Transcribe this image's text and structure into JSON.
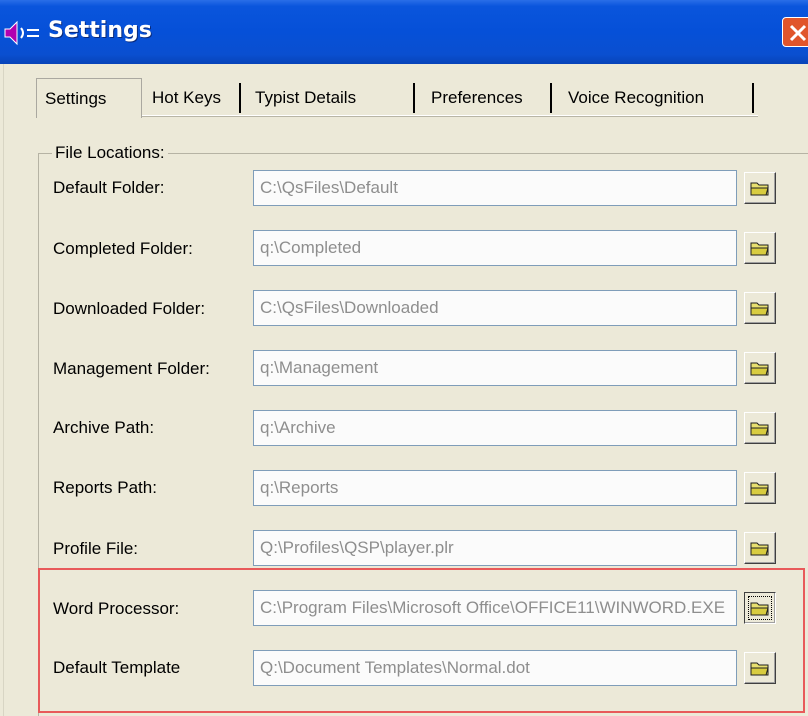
{
  "window": {
    "title": "Settings",
    "app_icon": "speaker-icon",
    "close_icon": "close-icon"
  },
  "tabs": [
    {
      "label": "Settings",
      "active": true
    },
    {
      "label": "Hot Keys"
    },
    {
      "label": "Typist Details"
    },
    {
      "label": "Preferences"
    },
    {
      "label": "Voice Recognition"
    }
  ],
  "group": {
    "label": "File Locations:"
  },
  "rows": [
    {
      "label": "Default Folder:",
      "value": "C:\\QsFiles\\Default"
    },
    {
      "label": "Completed Folder:",
      "value": "q:\\Completed"
    },
    {
      "label": "Downloaded Folder:",
      "value": "C:\\QsFiles\\Downloaded"
    },
    {
      "label": "Management Folder:",
      "value": "q:\\Management"
    },
    {
      "label": "Archive Path:",
      "value": "q:\\Archive"
    },
    {
      "label": "Reports Path:",
      "value": "q:\\Reports"
    },
    {
      "label": "Profile File:",
      "value": "Q:\\Profiles\\QSP\\player.plr"
    },
    {
      "label": "Word Processor:",
      "value": "C:\\Program Files\\Microsoft Office\\OFFICE11\\WINWORD.EXE"
    },
    {
      "label": "Default Template",
      "value": "Q:\\Document Templates\\Normal.dot"
    }
  ],
  "browse_icon": "folder-open-icon",
  "colors": {
    "titlebar": "#0650d8",
    "dialog_bg": "#ece9d8",
    "highlight": "#e85a5a",
    "field_text": "#8e8e8e"
  }
}
